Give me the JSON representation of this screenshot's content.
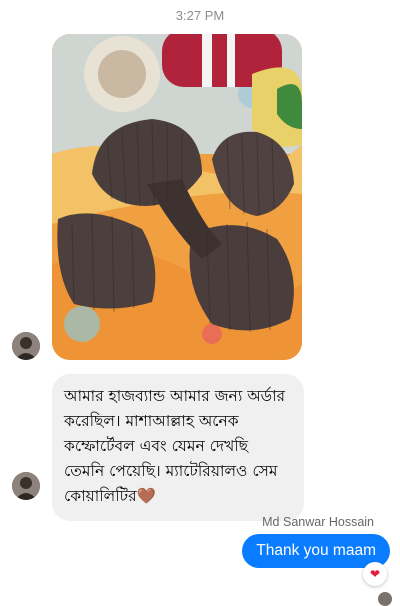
{
  "thread": {
    "timestamp": "3:27 PM"
  },
  "messages": {
    "incoming_text": "আমার হাজব্যান্ড আমার জন্য অর্ডার করেছিল। মাশাআল্লাহ অনেক কম্ফোর্টেবল এবং যেমন দেখছি তেমনি পেয়েছি। ম্যাটেরিয়ালও সেম কোয়ালিটির🤎",
    "sender_name": "Md Sanwar Hossain",
    "outgoing_text": "Thank you maam",
    "reaction": "❤"
  },
  "colors": {
    "outgoing_bubble": "#0a7cff",
    "incoming_bubble": "#f0f0f0",
    "reaction_heart": "#e41e3f"
  },
  "icons": {
    "photo": "product-photo-pillow",
    "avatar": "customer-avatar",
    "reaction": "heart-icon"
  }
}
